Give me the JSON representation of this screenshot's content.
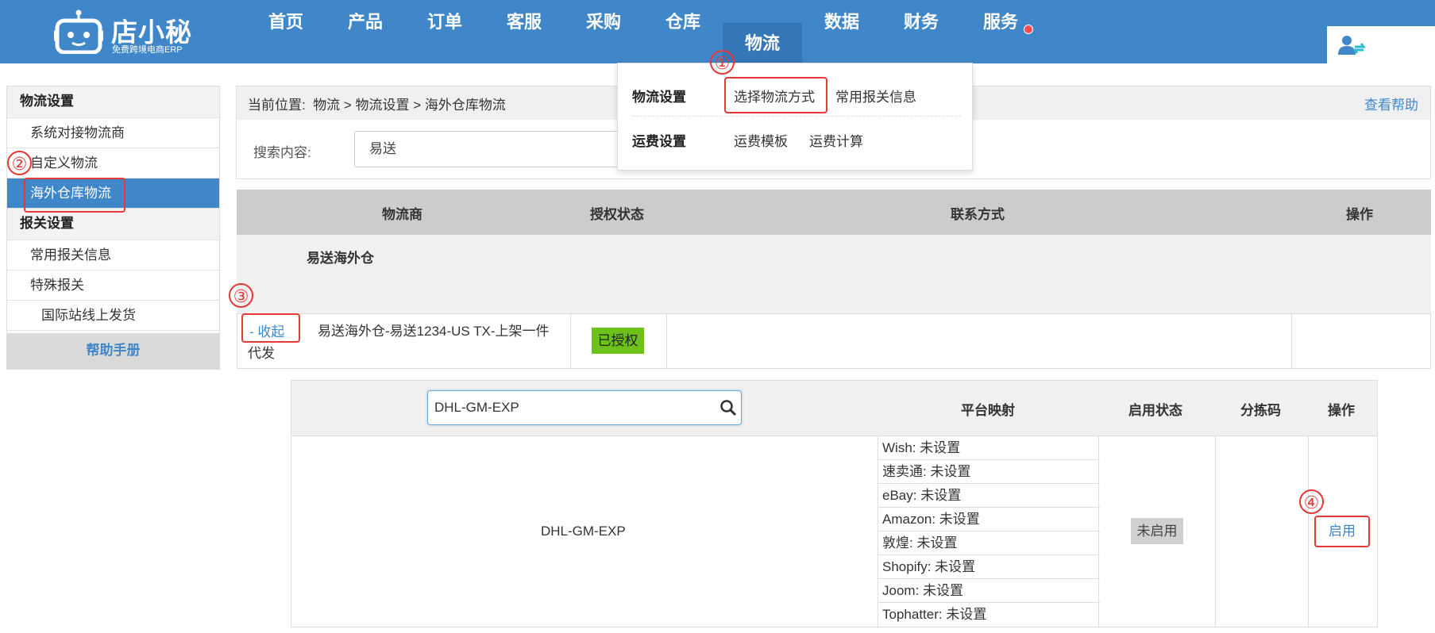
{
  "brand": {
    "name": "店小秘",
    "tagline": "免费跨境电商ERP"
  },
  "nav": [
    "首页",
    "产品",
    "订单",
    "客服",
    "采购",
    "仓库",
    "物流",
    "数据",
    "财务",
    "服务"
  ],
  "nav_active": "物流",
  "sidebar": {
    "section1": "物流设置",
    "items1": [
      "系统对接物流商",
      "自定义物流",
      "海外仓库物流"
    ],
    "section2": "报关设置",
    "items2": [
      "常用报关信息",
      "特殊报关"
    ],
    "sub_item": "国际站线上发货",
    "help": "帮助手册"
  },
  "breadcrumb": {
    "prefix": "当前位置:",
    "path": "物流 > 物流设置 > 海外仓库物流",
    "help": "查看帮助"
  },
  "search": {
    "label": "搜索内容:",
    "value": "易送"
  },
  "dropdown": {
    "group1": "物流设置",
    "g1_links": [
      "选择物流方式",
      "常用报关信息"
    ],
    "group2": "运费设置",
    "g2_links": [
      "运费模板",
      "运费计算"
    ]
  },
  "table": {
    "headers": [
      "物流商",
      "授权状态",
      "联系方式",
      "操作"
    ],
    "provider": "易送海外仓",
    "collapse": "- 收起",
    "detail_line1": "易送海外仓-易送1234-US TX-上架一件",
    "detail_line2": "代发",
    "auth_status": "已授权"
  },
  "subtable": {
    "search_value": "DHL-GM-EXP",
    "headers": [
      "平台映射",
      "启用状态",
      "分拣码",
      "操作"
    ],
    "shipping_method": "DHL-GM-EXP",
    "mappings": [
      "Wish: 未设置",
      "速卖通: 未设置",
      "eBay: 未设置",
      "Amazon: 未设置",
      "敦煌: 未设置",
      "Shopify: 未设置",
      "Joom: 未设置",
      "Tophatter: 未设置"
    ],
    "status": "未启用",
    "action": "启用"
  },
  "annotations": [
    "①",
    "②",
    "③",
    "④"
  ],
  "colors": {
    "primary": "#3f87c9",
    "annotation_red": "#e53935",
    "authorized_green": "#6cc21b"
  }
}
